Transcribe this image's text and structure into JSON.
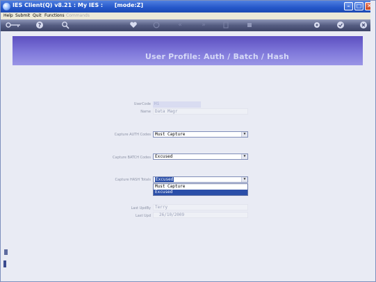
{
  "window": {
    "title": "IES Client(Q) v8.21 : My IES :      [mode:Z]"
  },
  "menu": [
    {
      "label": "Help",
      "enabled": true
    },
    {
      "label": "Submit",
      "enabled": true
    },
    {
      "label": "Quit",
      "enabled": true
    },
    {
      "label": "Functions",
      "enabled": true
    },
    {
      "label": "Commands",
      "enabled": false
    }
  ],
  "toolbar": {
    "icons": [
      "key-icon",
      "help-icon",
      "search-icon",
      "heart-icon",
      "refresh-icon",
      "double-left-icon",
      "double-right-icon",
      "copy-icon",
      "stop-icon",
      "settings-icon",
      "check-icon",
      "close-icon"
    ]
  },
  "header": {
    "title": "User Profile: Auth / Batch / Hash"
  },
  "form": {
    "user_code": {
      "label": "UserCode",
      "value": "Hi"
    },
    "name": {
      "label": "Name",
      "value": "Data Magr"
    },
    "auth": {
      "label": "Capture AUTH Codes",
      "value": "Must Capture"
    },
    "batch": {
      "label": "Capture BATCH Codes",
      "value": "Excused"
    },
    "hash": {
      "label": "Capture HASH Totals",
      "value": "Excused",
      "options": [
        "Must Capture",
        "Excused"
      ],
      "highlighted": "Excused"
    },
    "last_upd_by": {
      "label": "Last UpdBy",
      "value": "Terry"
    },
    "last_upd": {
      "label": "Last Upd",
      "value": "26/10/2009"
    }
  },
  "colors": {
    "titlebar": "#2456c9",
    "header": "#6b62cd",
    "selection": "#2a4ea8",
    "background": "#e9ebf4"
  }
}
